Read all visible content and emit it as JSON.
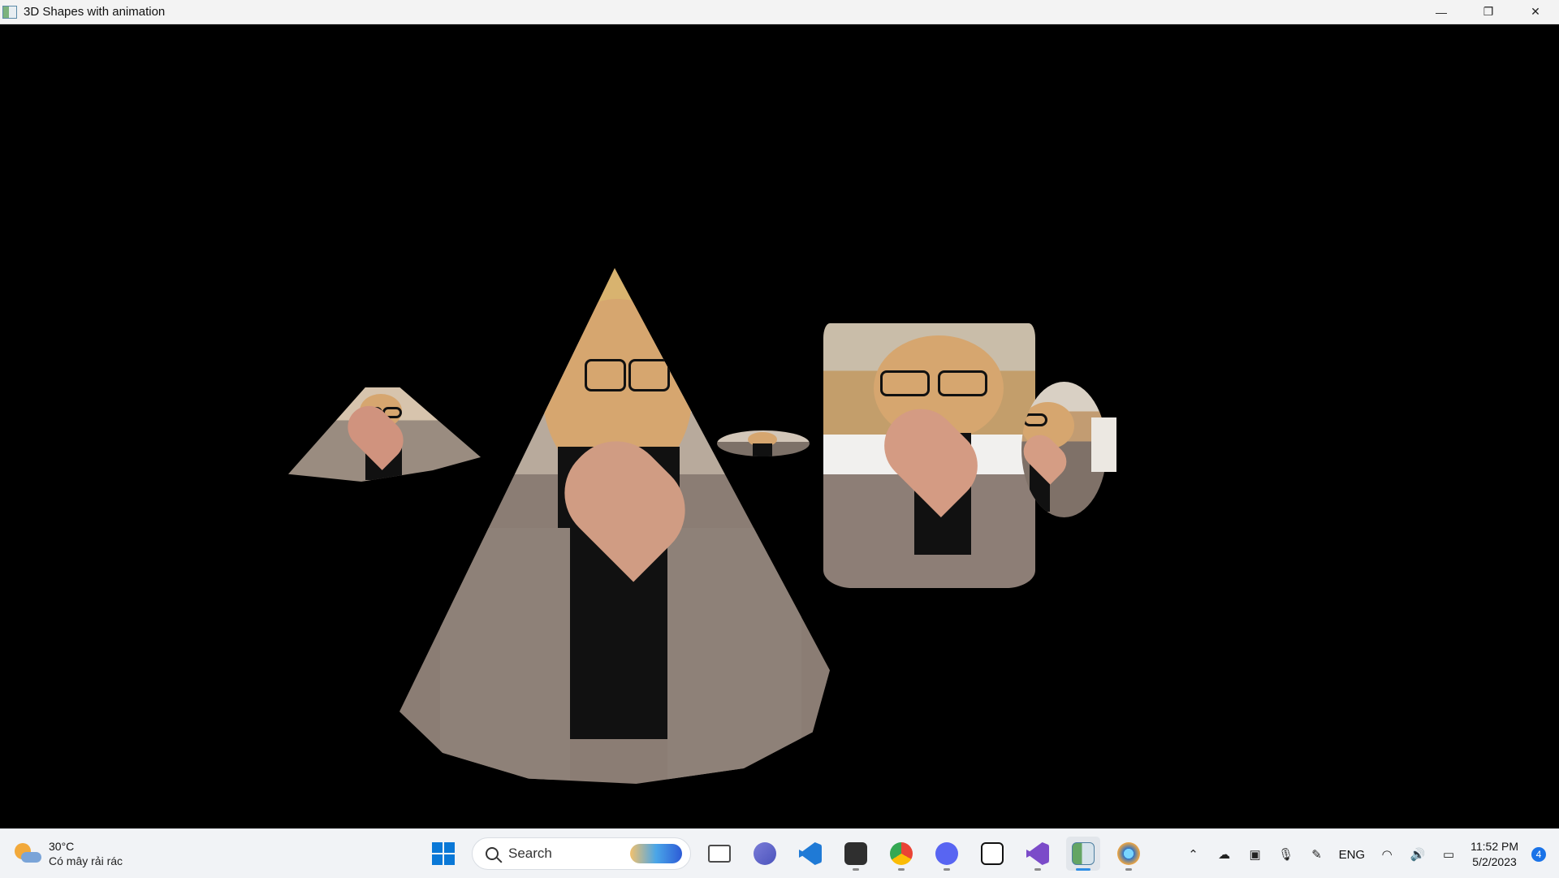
{
  "window": {
    "title": "3D Shapes with animation",
    "controls": {
      "minimize": "—",
      "restore": "❐",
      "close": "✕"
    }
  },
  "scene": {
    "background": "#000000",
    "objects": [
      {
        "name": "main-cone",
        "shape": "cone",
        "texture": "portrait"
      },
      {
        "name": "small-cone",
        "shape": "cone",
        "texture": "portrait"
      },
      {
        "name": "cylinder",
        "shape": "cylinder",
        "texture": "portrait"
      },
      {
        "name": "sphere",
        "shape": "sphere",
        "texture": "portrait"
      },
      {
        "name": "cube",
        "shape": "cube",
        "texture": "portrait"
      },
      {
        "name": "thin-shape",
        "shape": "disk",
        "texture": "portrait"
      }
    ]
  },
  "taskbar": {
    "weather": {
      "temperature": "30°C",
      "description": "Có mây rải rác",
      "icon": "partly-cloudy-icon"
    },
    "search": {
      "placeholder": "Search",
      "icon": "search-icon"
    },
    "apps": [
      {
        "name": "Windows Start",
        "icon": "windows-start-icon"
      },
      {
        "name": "Task View",
        "icon": "task-view-icon"
      },
      {
        "name": "Teams",
        "icon": "teams-icon"
      },
      {
        "name": "Visual Studio Code",
        "icon": "vscode-icon"
      },
      {
        "name": "Terminal",
        "icon": "terminal-icon"
      },
      {
        "name": "Chrome",
        "icon": "chrome-icon"
      },
      {
        "name": "Discord",
        "icon": "discord-icon"
      },
      {
        "name": "Notion",
        "icon": "notion-icon"
      },
      {
        "name": "Visual Studio",
        "icon": "visual-studio-icon"
      },
      {
        "name": "Current app",
        "icon": "app-window-icon"
      },
      {
        "name": "Browser",
        "icon": "globe-icon"
      }
    ],
    "tray": {
      "language": "ENG",
      "time": "11:52 PM",
      "date": "5/2/2023",
      "notification_count": "4"
    }
  }
}
